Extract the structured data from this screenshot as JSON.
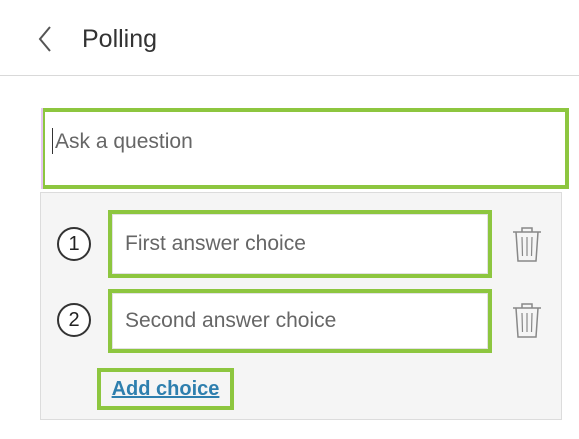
{
  "header": {
    "title": "Polling",
    "back_icon": "chevron-left-icon"
  },
  "question": {
    "placeholder": "Ask a question",
    "value": ""
  },
  "choices": [
    {
      "number": "1",
      "placeholder": "First answer choice",
      "value": ""
    },
    {
      "number": "2",
      "placeholder": "Second answer choice",
      "value": ""
    }
  ],
  "add_choice_label": "Add choice",
  "colors": {
    "highlight": "#8dc63f",
    "link": "#2e7fae",
    "panel": "#f5f5f5",
    "text": "#333333"
  },
  "icons": {
    "delete": "trash-icon"
  }
}
